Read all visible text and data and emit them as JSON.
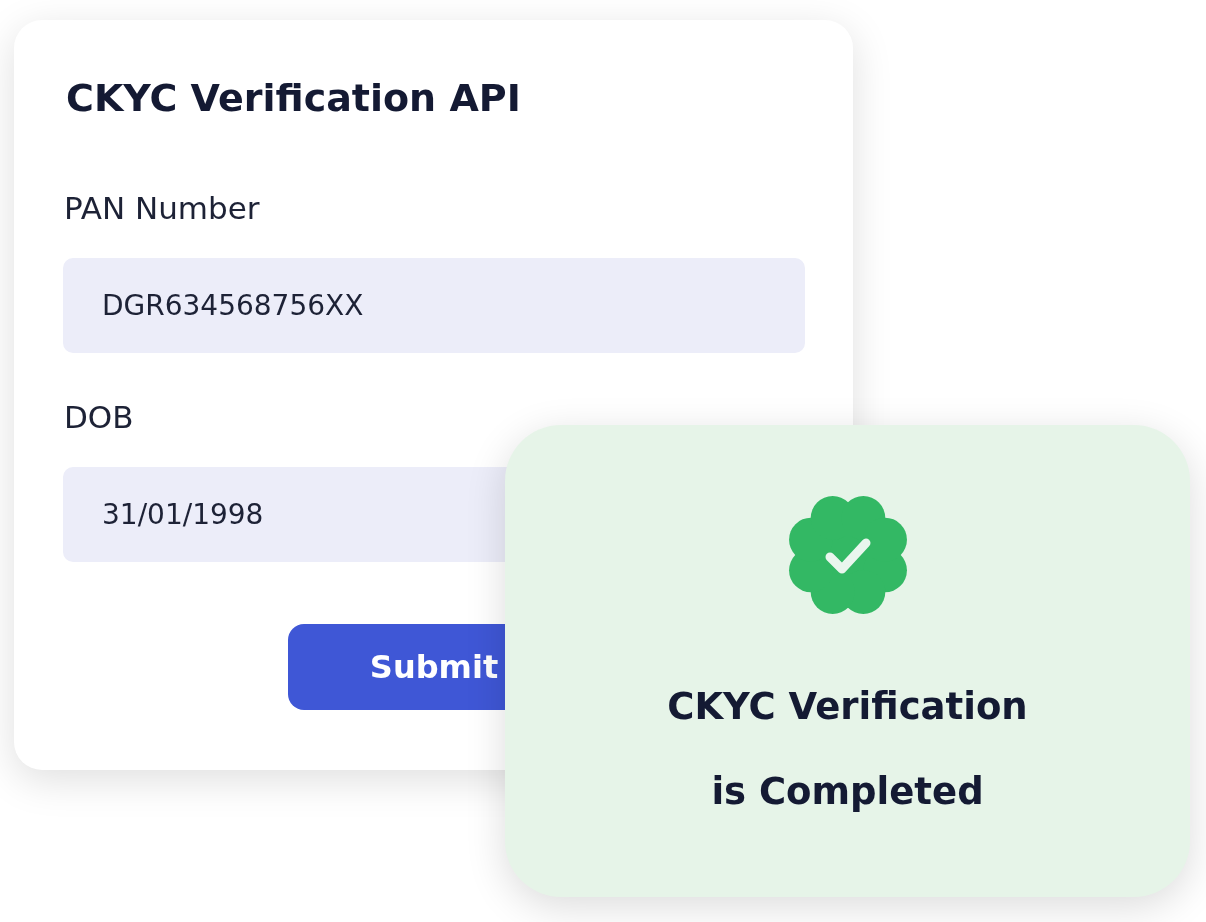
{
  "form": {
    "title": "CKYC Verification API",
    "fields": [
      {
        "label": "PAN Number",
        "value": "DGR634568756XX"
      },
      {
        "label": "DOB",
        "value": "31/01/1998"
      }
    ],
    "submit": "Submit"
  },
  "result": {
    "verified": true,
    "lines": [
      "CKYC Verification",
      "is Completed"
    ]
  }
}
